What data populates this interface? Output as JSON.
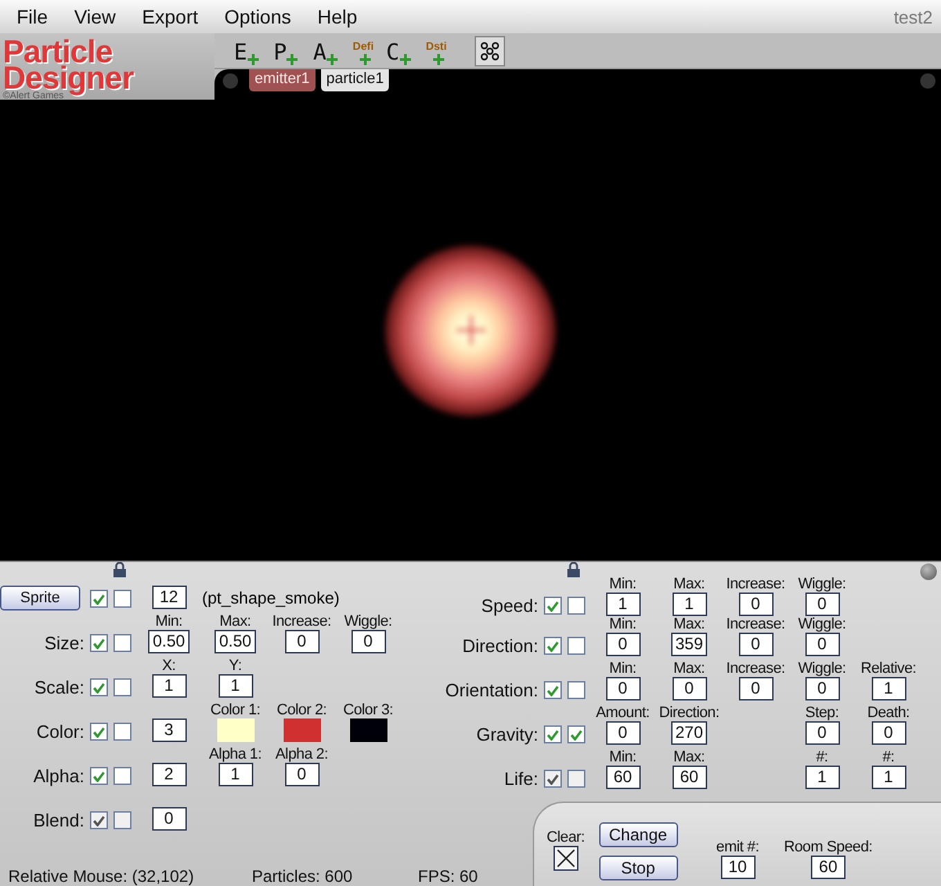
{
  "menu": [
    "File",
    "View",
    "Export",
    "Options",
    "Help"
  ],
  "window": {
    "title": "test2"
  },
  "logo": {
    "line_1": "Particle",
    "line_2": "Designer",
    "credit": "©Alert Games"
  },
  "toolbar": [
    {
      "label": "E",
      "kind": "letter"
    },
    {
      "label": "P",
      "kind": "letter"
    },
    {
      "label": "A",
      "kind": "letter"
    },
    {
      "label": "Defi",
      "kind": "small"
    },
    {
      "label": "C",
      "kind": "letter"
    },
    {
      "label": "Dsti",
      "kind": "small"
    }
  ],
  "tabs": [
    {
      "label": "emitter1",
      "selected": true
    },
    {
      "label": "particle1",
      "selected": false
    }
  ],
  "left_properties": [
    {
      "kind": "button",
      "label": "Sprite",
      "checks": [
        {
          "checked": true,
          "kind": "green"
        },
        {
          "checked": false,
          "kind": "green"
        }
      ],
      "fields": [
        {
          "kind": "input",
          "value": "12"
        }
      ],
      "note": "(pt_shape_smoke)"
    },
    {
      "kind": "label",
      "label": "Size:",
      "checks": [
        {
          "checked": true,
          "kind": "green"
        },
        {
          "checked": false,
          "kind": "green"
        }
      ],
      "fields": [
        {
          "kind": "input",
          "caption": "Min:",
          "value": "0.50"
        },
        {
          "kind": "input",
          "caption": "Max:",
          "value": "0.50"
        },
        {
          "kind": "input",
          "caption": "Increase:",
          "value": "0"
        },
        {
          "kind": "input",
          "caption": "Wiggle:",
          "value": "0"
        }
      ]
    },
    {
      "kind": "label",
      "label": "Scale:",
      "checks": [
        {
          "checked": true,
          "kind": "green"
        },
        {
          "checked": false,
          "kind": "green"
        }
      ],
      "fields": [
        {
          "kind": "input",
          "caption": "X:",
          "value": "1"
        },
        {
          "kind": "input",
          "caption": "Y:",
          "value": "1"
        }
      ]
    },
    {
      "kind": "label",
      "label": "Color:",
      "checks": [
        {
          "checked": true,
          "kind": "green"
        },
        {
          "checked": false,
          "kind": "green"
        }
      ],
      "fields": [
        {
          "kind": "input",
          "value": "3"
        },
        {
          "kind": "swatch",
          "caption": "Color 1:",
          "color": "#ffffc8"
        },
        {
          "kind": "swatch",
          "caption": "Color 2:",
          "color": "#d03030"
        },
        {
          "kind": "swatch",
          "caption": "Color 3:",
          "color": "#000008"
        }
      ]
    },
    {
      "kind": "label",
      "label": "Alpha:",
      "checks": [
        {
          "checked": true,
          "kind": "green"
        },
        {
          "checked": false,
          "kind": "green"
        }
      ],
      "fields": [
        {
          "kind": "input",
          "value": "2"
        },
        {
          "kind": "input",
          "caption": "Alpha 1:",
          "value": "1"
        },
        {
          "kind": "input",
          "caption": "Alpha 2:",
          "value": "0"
        }
      ]
    },
    {
      "kind": "label",
      "label": "Blend:",
      "checks": [
        {
          "checked": true,
          "kind": "grey"
        },
        {
          "checked": false,
          "kind": "grey"
        }
      ],
      "fields": [
        {
          "kind": "input",
          "value": "0"
        }
      ]
    }
  ],
  "right_properties": [
    {
      "kind": "label",
      "label": "Speed:",
      "checks": [
        {
          "checked": true,
          "kind": "green"
        },
        {
          "checked": false,
          "kind": "green"
        }
      ],
      "fields": [
        {
          "kind": "input",
          "caption": "Min:",
          "value": "1"
        },
        {
          "kind": "input",
          "caption": "Max:",
          "value": "1"
        },
        {
          "kind": "input",
          "caption": "Increase:",
          "value": "0"
        },
        {
          "kind": "input",
          "caption": "Wiggle:",
          "value": "0"
        }
      ]
    },
    {
      "kind": "label",
      "label": "Direction:",
      "checks": [
        {
          "checked": true,
          "kind": "green"
        },
        {
          "checked": false,
          "kind": "green"
        }
      ],
      "fields": [
        {
          "kind": "input",
          "caption": "Min:",
          "value": "0"
        },
        {
          "kind": "input",
          "caption": "Max:",
          "value": "359"
        },
        {
          "kind": "input",
          "caption": "Increase:",
          "value": "0"
        },
        {
          "kind": "input",
          "caption": "Wiggle:",
          "value": "0"
        }
      ]
    },
    {
      "kind": "label",
      "label": "Orientation:",
      "checks": [
        {
          "checked": true,
          "kind": "green"
        },
        {
          "checked": false,
          "kind": "green"
        }
      ],
      "fields": [
        {
          "kind": "input",
          "caption": "Min:",
          "value": "0"
        },
        {
          "kind": "input",
          "caption": "Max:",
          "value": "0"
        },
        {
          "kind": "input",
          "caption": "Increase:",
          "value": "0"
        },
        {
          "kind": "input",
          "caption": "Wiggle:",
          "value": "0"
        },
        {
          "kind": "input",
          "caption": "Relative:",
          "value": "1"
        }
      ]
    },
    {
      "kind": "label",
      "label": "Gravity:",
      "checks": [
        {
          "checked": true,
          "kind": "green"
        },
        {
          "checked": true,
          "kind": "green"
        }
      ],
      "fields": [
        {
          "kind": "input",
          "caption": "Amount:",
          "value": "0"
        },
        {
          "kind": "input",
          "caption": "Direction:",
          "value": "270"
        }
      ],
      "extra": [
        {
          "kind": "input",
          "caption": "Step:",
          "value": "0"
        },
        {
          "kind": "input",
          "caption": "Death:",
          "value": "0"
        }
      ]
    },
    {
      "kind": "label",
      "label": "Life:",
      "checks": [
        {
          "checked": true,
          "kind": "grey"
        },
        {
          "checked": false,
          "kind": "grey"
        }
      ],
      "fields": [
        {
          "kind": "input",
          "caption": "Min:",
          "value": "60"
        },
        {
          "kind": "input",
          "caption": "Max:",
          "value": "60"
        }
      ],
      "extra": [
        {
          "kind": "input",
          "caption": "#:",
          "value": "1"
        },
        {
          "kind": "input",
          "caption": "#:",
          "value": "1"
        }
      ]
    }
  ],
  "actions": {
    "clear": {
      "label": "Clear:",
      "checked": true
    },
    "buttons": [
      "Change",
      "Stop"
    ],
    "fields": [
      {
        "caption": "emit #:",
        "value": "10"
      },
      {
        "caption": "Room Speed:",
        "value": "60"
      }
    ]
  },
  "status_bar": [
    "Relative Mouse: (32,102)",
    "Particles: 600",
    "FPS: 60"
  ]
}
